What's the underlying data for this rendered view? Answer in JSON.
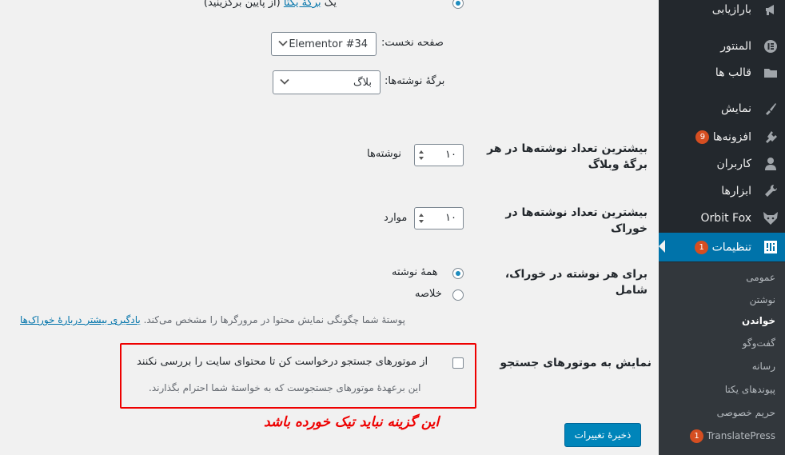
{
  "sidebar": {
    "items": [
      {
        "label": "بارازیابی",
        "icon": "megaphone-icon"
      },
      {
        "label": "المنتور",
        "icon": "elementor-icon"
      },
      {
        "label": "قالب ها",
        "icon": "folder-icon"
      },
      {
        "label": "نمایش",
        "icon": "paintbrush-icon"
      },
      {
        "label": "افزونه‌ها",
        "icon": "plugin-icon",
        "badge": "9"
      },
      {
        "label": "کاربران",
        "icon": "user-icon"
      },
      {
        "label": "ابزارها",
        "icon": "wrench-icon"
      },
      {
        "label": "Orbit Fox",
        "icon": "fox-icon"
      },
      {
        "label": "تنظیمات",
        "icon": "settings-icon",
        "badge": "1",
        "active": true
      }
    ],
    "submenu": [
      {
        "label": "عمومی"
      },
      {
        "label": "نوشتن"
      },
      {
        "label": "خواندن",
        "current": true
      },
      {
        "label": "گفت‌وگو"
      },
      {
        "label": "رسانه"
      },
      {
        "label": "پیوندهای یکتا"
      },
      {
        "label": "حریم خصوصی"
      },
      {
        "label": "TranslatePress",
        "badge": "1"
      }
    ]
  },
  "reading": {
    "static_page_option": {
      "prefix": "یک",
      "link": "برگهٔ یکتا",
      "suffix": "(از پایین برگزینید)"
    },
    "front_page": {
      "label": "صفحه نخست:",
      "value": "Elementor #34"
    },
    "posts_page": {
      "label": "برگهٔ نوشته‌ها:",
      "value": "بلاگ"
    },
    "posts_per_page": {
      "label": "بیشترین تعداد نوشته‌ها در هر برگهٔ وبلاگ",
      "value": "۱۰",
      "unit": "نوشته‌ها"
    },
    "posts_per_rss": {
      "label": "بیشترین تعداد نوشته‌ها در خوراک",
      "value": "۱۰",
      "unit": "موارد"
    },
    "rss_use_excerpt": {
      "label": "برای هر نوشته در خوراک، شامل",
      "options": [
        "همهٔ نوشته",
        "خلاصه"
      ],
      "selected": 0
    },
    "feed_description": "پوستهٔ شما چگونگی نمایش محتوا در مرورگرها را مشخص می‌کند.",
    "feed_link": "یادگیری بیشتر دربارهٔ خوراک‌ها",
    "search_engine": {
      "label": "نمایش به موتورهای جستجو",
      "checkbox_label": "از موتورهای جستجو درخواست کن تا محتوای سایت را بررسی نکنند",
      "description": "این برعهدهٔ موتورهای جستجوست که به خواستهٔ شما احترام بگذارند."
    },
    "annotation": "این گزینه نباید تیک خورده باشد",
    "save_label": "ذخیرهٔ تغییرات"
  },
  "colors": {
    "accent": "#0073aa",
    "sidebar_bg": "#23282d",
    "highlight": "#e00000"
  }
}
